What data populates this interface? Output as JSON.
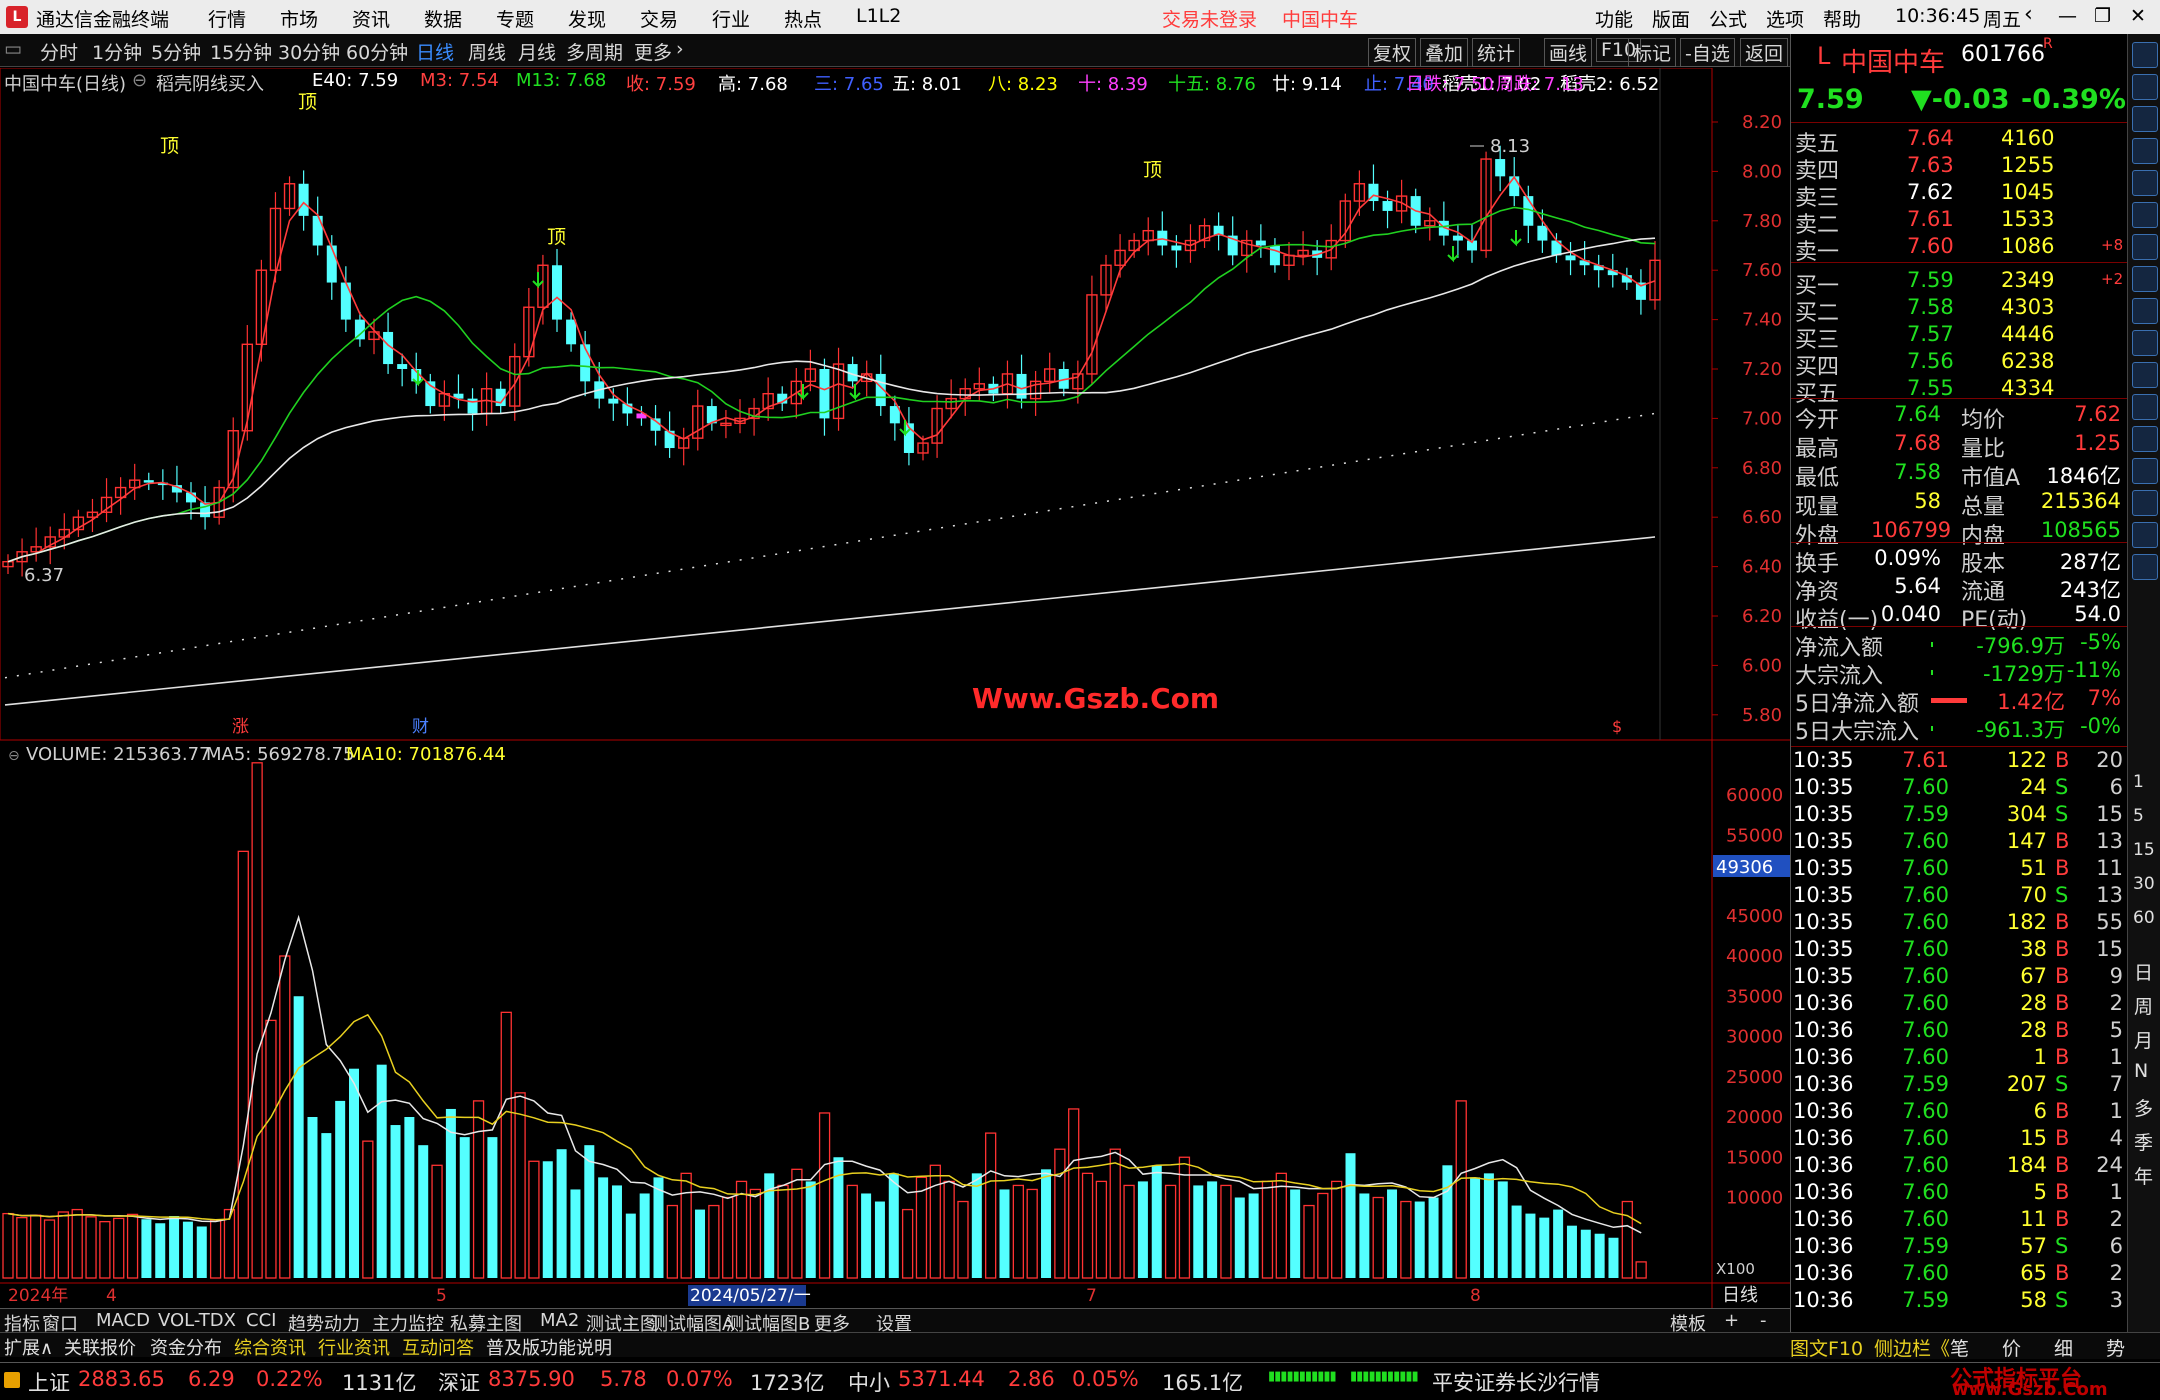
{
  "titlebar": {
    "app_name": "通达信金融终端",
    "menus": [
      "行情",
      "市场",
      "资讯",
      "数据",
      "专题",
      "发现",
      "交易",
      "行业",
      "热点",
      "L1L2"
    ],
    "login_status": "交易未登录",
    "stock": "中国中车",
    "right_menus": [
      "功能",
      "版面",
      "公式",
      "选项",
      "帮助"
    ],
    "time": "10:36:45",
    "weekday": "周五"
  },
  "period_bar": {
    "periods": [
      "分时",
      "1分钟",
      "5分钟",
      "15分钟",
      "30分钟",
      "60分钟",
      "日线",
      "周线",
      "月线",
      "多周期",
      "更多"
    ],
    "active": "日线",
    "tools": [
      "复权",
      "叠加",
      "统计",
      "画线",
      "F10",
      "标记",
      "-自选",
      "返回"
    ]
  },
  "chart_legend": {
    "stock_label": "中国中车(日线)",
    "formula": "稻壳阴线买入",
    "items": [
      {
        "text": "E40: 7.59",
        "color": "#ffffff"
      },
      {
        "text": "M3: 7.54",
        "color": "#ff4040"
      },
      {
        "text": "M13: 7.68",
        "color": "#20e020"
      },
      {
        "text": "收: 7.59",
        "color": "#ff4040"
      },
      {
        "text": "高: 7.68",
        "color": "#ffffff"
      },
      {
        "text": "三: 7.65",
        "color": "#4060ff"
      },
      {
        "text": "五: 8.01",
        "color": "#ffffff"
      },
      {
        "text": "八: 8.23",
        "color": "#ffff00"
      },
      {
        "text": "十: 8.39",
        "color": "#ff40ff"
      },
      {
        "text": "十五: 8.76",
        "color": "#20e020"
      },
      {
        "text": "廿: 9.14",
        "color": "#ffffff"
      },
      {
        "text": "止: 7.40",
        "color": "#4060ff"
      },
      {
        "text": "稻壳1: 7.02",
        "color": "#ffffff"
      },
      {
        "text": "稻壳2: 6.52",
        "color": "#ffffff"
      },
      {
        "text": "日跌: 7.50",
        "color": "#ff40ff"
      },
      {
        "text": "周跌: 7.13",
        "color": "#ff40ff"
      }
    ]
  },
  "price_axis": [
    "8.20",
    "8.00",
    "7.80",
    "7.60",
    "7.40",
    "7.20",
    "7.00",
    "6.80",
    "6.60",
    "6.40",
    "6.20",
    "6.00",
    "5.80"
  ],
  "price_markers": {
    "high": "8.13",
    "low": "6.37"
  },
  "signal_label": "顶",
  "event_labels": [
    "涨",
    "财"
  ],
  "watermark_center": "Www.Gszb.Com",
  "volume_legend": {
    "label": "VOLUME: 215363.77",
    "ma5": "MA5: 569278.75",
    "ma10": "MA10: 701876.44"
  },
  "volume_axis": [
    "60000",
    "55000",
    "45000",
    "40000",
    "35000",
    "30000",
    "25000",
    "20000",
    "15000",
    "10000"
  ],
  "volume_marker": "49306",
  "volume_unit": "X100",
  "date_axis": {
    "year": "2024年",
    "m1": "4",
    "m2": "5",
    "cursor_date": "2024/05/27/一",
    "m3": "7",
    "m4": "8",
    "period": "日线"
  },
  "indicator_tabs": [
    "指标",
    "窗口",
    "MACD",
    "VOL-TDX",
    "CCI",
    "趋势动力",
    "主力监控",
    "私募主图",
    "MA2",
    "测试主图",
    "测试幅图A",
    "测试幅图B",
    "更多",
    "设置"
  ],
  "indicator_right": [
    "模板",
    "+",
    "-"
  ],
  "bottom_tabs": [
    "扩展∧",
    "关联报价",
    "资金分布",
    "综合资讯",
    "行业资讯",
    "互动问答",
    "普及版功能说明"
  ],
  "bottom_right": [
    "图文F10",
    "侧边栏《",
    "笔",
    "价",
    "细",
    "势"
  ],
  "status": {
    "sh_label": "上证",
    "sh": "2883.65",
    "sh_chg": "6.29",
    "sh_pct": "0.22%",
    "sh_amt": "1131亿",
    "sz_label": "深证",
    "sz": "8375.90",
    "sz_chg": "5.78",
    "sz_pct": "0.07%",
    "sz_amt": "1723亿",
    "zx_label": "中小",
    "zx": "5371.44",
    "zx_chg": "2.86",
    "zx_pct": "0.05%",
    "zx_amt": "165.1亿",
    "broker": "平安证券长沙行情",
    "site": "公式指标平台",
    "site_url": "www.Gszb.Com"
  },
  "quote": {
    "name": "中国中车",
    "code": "601766",
    "badge": "R",
    "price": "7.59",
    "change": "▼-0.03",
    "pct": "-0.39%",
    "asks": [
      [
        "卖五",
        "7.64",
        "4160",
        ""
      ],
      [
        "卖四",
        "7.63",
        "1255",
        ""
      ],
      [
        "卖三",
        "7.62",
        "1045",
        ""
      ],
      [
        "卖二",
        "7.61",
        "1533",
        ""
      ],
      [
        "卖一",
        "7.60",
        "1086",
        "+8"
      ]
    ],
    "bids": [
      [
        "买一",
        "7.59",
        "2349",
        "+2"
      ],
      [
        "买二",
        "7.58",
        "4303",
        ""
      ],
      [
        "买三",
        "7.57",
        "4446",
        ""
      ],
      [
        "买四",
        "7.56",
        "6238",
        ""
      ],
      [
        "买五",
        "7.55",
        "4334",
        ""
      ]
    ],
    "stats": [
      [
        "今开",
        "7.64",
        "均价",
        "7.62"
      ],
      [
        "最高",
        "7.68",
        "量比",
        "1.25"
      ],
      [
        "最低",
        "7.58",
        "市值A",
        "1846亿"
      ],
      [
        "现量",
        "58",
        "总量",
        "215364"
      ],
      [
        "外盘",
        "106799",
        "内盘",
        "108565"
      ]
    ],
    "fund": [
      [
        "换手",
        "0.09%",
        "股本",
        "287亿"
      ],
      [
        "净资",
        "5.64",
        "流通",
        "243亿"
      ],
      [
        "收益(一)",
        "0.040",
        "PE(动)",
        "54.0"
      ]
    ],
    "flows": [
      [
        "净流入额",
        "-796.9万",
        "-5%"
      ],
      [
        "大宗流入",
        "-1729万",
        "-11%"
      ],
      [
        "5日净流入额",
        "1.42亿",
        "7%"
      ],
      [
        "5日大宗流入",
        "-961.3万",
        "-0%"
      ]
    ],
    "ticks": [
      [
        "10:35",
        "7.61",
        "122",
        "B",
        "20"
      ],
      [
        "10:35",
        "7.60",
        "24",
        "S",
        "6"
      ],
      [
        "10:35",
        "7.59",
        "304",
        "S",
        "15"
      ],
      [
        "10:35",
        "7.60",
        "147",
        "B",
        "13"
      ],
      [
        "10:35",
        "7.60",
        "51",
        "B",
        "11"
      ],
      [
        "10:35",
        "7.60",
        "70",
        "S",
        "13"
      ],
      [
        "10:35",
        "7.60",
        "182",
        "B",
        "55"
      ],
      [
        "10:35",
        "7.60",
        "38",
        "B",
        "15"
      ],
      [
        "10:35",
        "7.60",
        "67",
        "B",
        "9"
      ],
      [
        "10:36",
        "7.60",
        "28",
        "B",
        "2"
      ],
      [
        "10:36",
        "7.60",
        "28",
        "B",
        "5"
      ],
      [
        "10:36",
        "7.60",
        "1",
        "B",
        "1"
      ],
      [
        "10:36",
        "7.59",
        "207",
        "S",
        "7"
      ],
      [
        "10:36",
        "7.60",
        "6",
        "B",
        "1"
      ],
      [
        "10:36",
        "7.60",
        "15",
        "B",
        "4"
      ],
      [
        "10:36",
        "7.60",
        "184",
        "B",
        "24"
      ],
      [
        "10:36",
        "7.60",
        "5",
        "B",
        "1"
      ],
      [
        "10:36",
        "7.60",
        "11",
        "B",
        "2"
      ],
      [
        "10:36",
        "7.59",
        "57",
        "S",
        "6"
      ],
      [
        "10:36",
        "7.60",
        "65",
        "B",
        "2"
      ],
      [
        "10:36",
        "7.59",
        "58",
        "S",
        "3"
      ]
    ]
  },
  "sidebar_periods": [
    "日",
    "周",
    "月",
    "N",
    "多",
    "季",
    "年"
  ],
  "sidebar_minutes": [
    "1",
    "5",
    "15",
    "30",
    "60"
  ]
}
